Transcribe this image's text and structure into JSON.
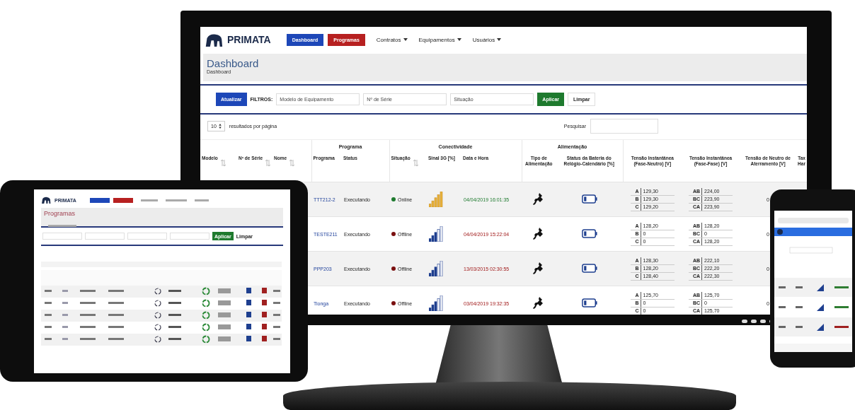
{
  "monitor": {
    "nav": {
      "logo": "PRIMATA",
      "buttons": [
        {
          "label": "Dashboard",
          "kind": "dashboard"
        },
        {
          "label": "Programas",
          "kind": "programs"
        }
      ],
      "menus": [
        "Contratos",
        "Equipamentos",
        "Usuários"
      ]
    },
    "page": {
      "title": "Dashboard",
      "breadcrumb": "Dashboard"
    },
    "filters": {
      "refresh": "Atualizar",
      "label": "FILTROS:",
      "fields": [
        {
          "placeholder": "Modelo de Equipamento"
        },
        {
          "placeholder": "Nº de Série"
        },
        {
          "placeholder": "Situação"
        }
      ],
      "apply": "Aplicar",
      "clear": "Limpar"
    },
    "paging": {
      "per_page": "10",
      "per_page_label": "resultados por página",
      "search_label": "Pesquisar"
    },
    "table": {
      "groups": [
        "Programa",
        "Conectividade",
        "Alimentação"
      ],
      "columns": [
        {
          "label": "Modelo",
          "sortable": true
        },
        {
          "label": "Nº de Série",
          "sortable": true
        },
        {
          "label": "Nome",
          "sortable": true
        },
        {
          "label": "Programa",
          "sortable": false
        },
        {
          "label": "Status",
          "sortable": false
        },
        {
          "label": "Situação",
          "sortable": true
        },
        {
          "label": "Sinal 3G [%]",
          "sortable": false
        },
        {
          "label": "Data e Hora",
          "sortable": false
        },
        {
          "label": "Tipo de Alimentação",
          "sortable": false
        },
        {
          "label": "Status da Bateria do Relógio-Calendário [%]",
          "sortable": false
        },
        {
          "label": "Tensão Instantânea (Fase-Neutro) [V]",
          "sortable": false
        },
        {
          "label": "Tensão Instantânea (Fase-Fase) [V]",
          "sortable": false
        },
        {
          "label": "Tensão de Neutro de Aterramento [V]",
          "sortable": false
        },
        {
          "label": "Tax Har",
          "sortable": false
        }
      ],
      "rows": [
        {
          "program": "TTT212-2",
          "status": "Executando",
          "situation": "Online",
          "online": true,
          "datetime": "04/04/2019 16:01:35",
          "fn": [
            {
              "phase": "A",
              "value": "129,30"
            },
            {
              "phase": "B",
              "value": "129,30"
            },
            {
              "phase": "C",
              "value": "129,20"
            }
          ],
          "ff": [
            {
              "phase": "AB",
              "value": "224,00"
            },
            {
              "phase": "BC",
              "value": "223,90"
            },
            {
              "phase": "CA",
              "value": "223,90"
            }
          ],
          "neutral": "0"
        },
        {
          "program": "TESTE211",
          "status": "Executando",
          "situation": "Offline",
          "online": false,
          "datetime": "04/04/2019 15:22:04",
          "fn": [
            {
              "phase": "A",
              "value": "128,20"
            },
            {
              "phase": "B",
              "value": "0"
            },
            {
              "phase": "C",
              "value": "0"
            }
          ],
          "ff": [
            {
              "phase": "AB",
              "value": "128,20"
            },
            {
              "phase": "BC",
              "value": "0"
            },
            {
              "phase": "CA",
              "value": "128,20"
            }
          ],
          "neutral": "0"
        },
        {
          "program": "PPP203",
          "status": "Executando",
          "situation": "Offline",
          "online": false,
          "datetime": "13/03/2015 02:30:55",
          "fn": [
            {
              "phase": "A",
              "value": "128,30"
            },
            {
              "phase": "B",
              "value": "128,20"
            },
            {
              "phase": "C",
              "value": "128,40"
            }
          ],
          "ff": [
            {
              "phase": "AB",
              "value": "222,10"
            },
            {
              "phase": "BC",
              "value": "222,20"
            },
            {
              "phase": "CA",
              "value": "222,30"
            }
          ],
          "neutral": "0"
        },
        {
          "program": "Tionga",
          "status": "Executando",
          "situation": "Offline",
          "online": false,
          "datetime": "03/04/2019 19:32:35",
          "fn": [
            {
              "phase": "A",
              "value": "125,70"
            },
            {
              "phase": "B",
              "value": "0"
            },
            {
              "phase": "C",
              "value": "0"
            }
          ],
          "ff": [
            {
              "phase": "AB",
              "value": "125,70"
            },
            {
              "phase": "BC",
              "value": "0"
            },
            {
              "phase": "CA",
              "value": "125,70"
            }
          ],
          "neutral": "0"
        }
      ]
    }
  },
  "tablet": {
    "logo": "PRIMATA",
    "title": "Programas",
    "apply": "Aplicar",
    "clear": "Limpar"
  }
}
